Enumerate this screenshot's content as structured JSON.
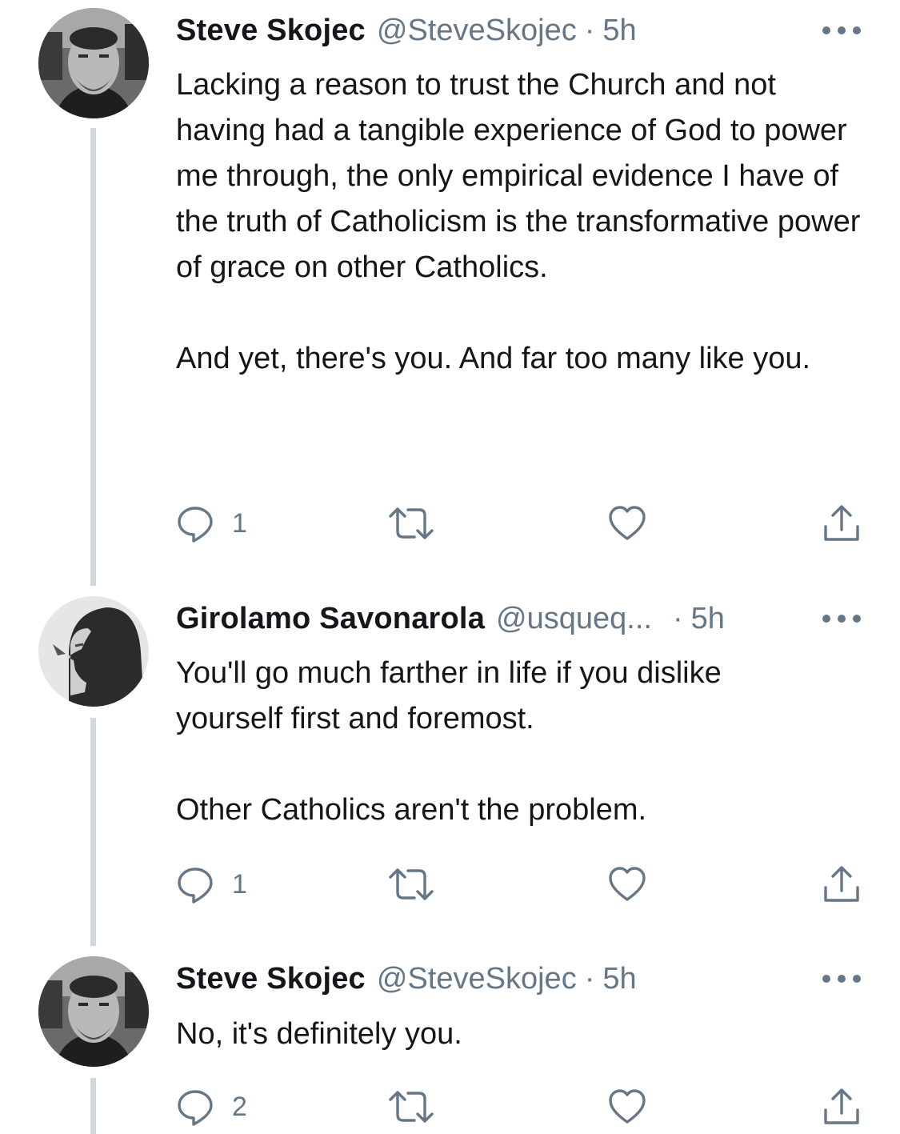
{
  "tweets": [
    {
      "name": "Steve Skojec",
      "handle": "@SteveSkojec",
      "time": "5h",
      "paragraphs": [
        "Lacking a reason to trust the Church and not having had a tangible experience of God to power me through, the only empirical evidence I have of the truth of Catholicism is the transformative power of grace on other Catholics.",
        "And yet, there's you. And far too many like you."
      ],
      "reply_count": "1"
    },
    {
      "name": "Girolamo Savonarola",
      "handle": "@usqueq...",
      "time": "5h",
      "paragraphs": [
        "You'll go much farther in life if you dislike yourself first and foremost.",
        "Other Catholics aren't the problem."
      ],
      "reply_count": "1"
    },
    {
      "name": "Steve Skojec",
      "handle": "@SteveSkojec",
      "time": "5h",
      "paragraphs": [
        "No, it's definitely you."
      ],
      "reply_count": "2"
    }
  ],
  "separator": "·",
  "icons": [
    "reply-icon",
    "retweet-icon",
    "like-icon",
    "share-icon",
    "more-icon"
  ],
  "colors": {
    "text": "#14171a",
    "secondary": "#657786",
    "thread_line": "#cfd9de",
    "background": "#ffffff"
  }
}
